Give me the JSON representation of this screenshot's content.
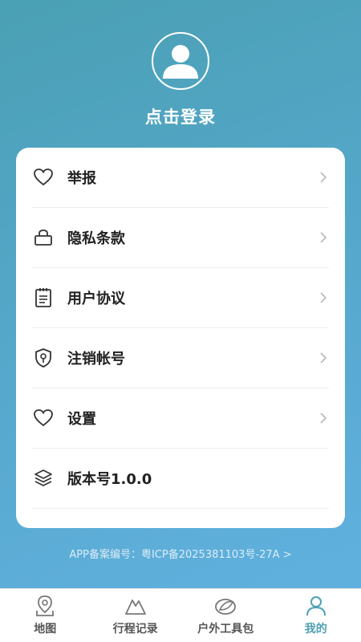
{
  "profile": {
    "login_label": "点击登录"
  },
  "menu": [
    {
      "label": "举报",
      "icon": "heart-icon",
      "has_arrow": true
    },
    {
      "label": "隐私条款",
      "icon": "lock-icon",
      "has_arrow": true
    },
    {
      "label": "用户协议",
      "icon": "notepad-icon",
      "has_arrow": true
    },
    {
      "label": "注销帐号",
      "icon": "shield-key-icon",
      "has_arrow": true
    },
    {
      "label": "设置",
      "icon": "heart-icon",
      "has_arrow": true
    },
    {
      "label": "版本号1.0.0",
      "icon": "layers-icon",
      "has_arrow": false
    }
  ],
  "icp": {
    "text": "APP备案编号：粤ICP备2025381103号-27A >"
  },
  "tabs": [
    {
      "label": "地图",
      "icon": "map-pin-icon",
      "active": false
    },
    {
      "label": "行程记录",
      "icon": "mountain-icon",
      "active": false
    },
    {
      "label": "户外工具包",
      "icon": "leaf-icon",
      "active": false
    },
    {
      "label": "我的",
      "icon": "person-icon",
      "active": true
    }
  ],
  "colors": {
    "accent": "#4fa0b3",
    "gradient_start": "#4aa0b4",
    "gradient_end": "#62b2e2"
  }
}
